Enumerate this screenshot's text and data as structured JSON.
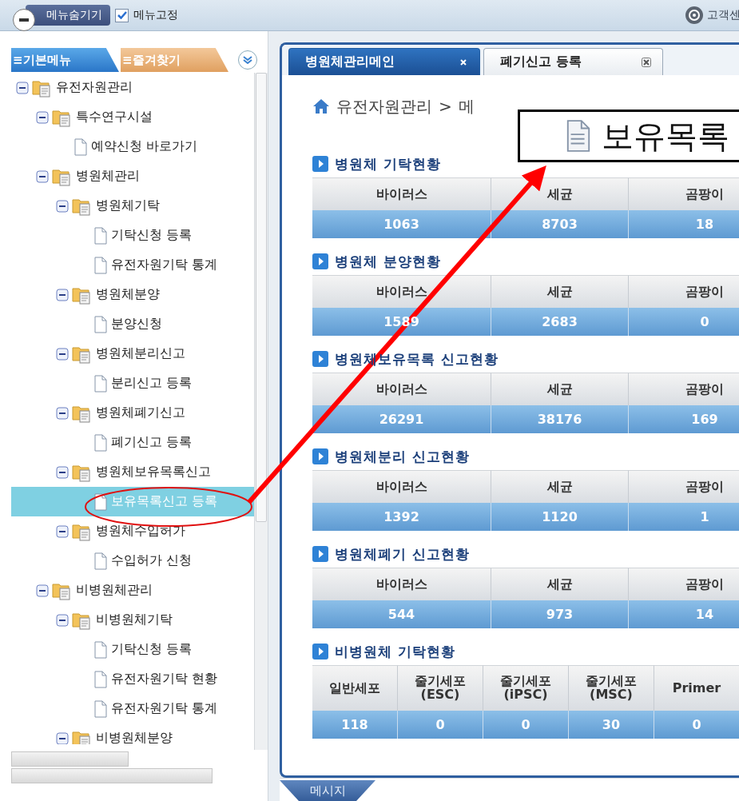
{
  "topbar": {
    "hide_menu_button": "메뉴숨기기",
    "pin_menu": {
      "label": "메뉴고정",
      "checked": true
    },
    "customer_center": "고객센"
  },
  "sidebar": {
    "tabs": [
      {
        "label": "≡기본메뉴",
        "selected": true
      },
      {
        "label": "≡즐겨찾기",
        "selected": false
      }
    ],
    "tree": [
      {
        "label": "유전자원관리",
        "kind": "folder",
        "expanded": true,
        "selected": false,
        "children": [
          {
            "label": "특수연구시설",
            "kind": "folder",
            "expanded": true,
            "selected": false,
            "children": [
              {
                "label": "예약신청 바로가기",
                "kind": "page",
                "selected": false
              }
            ]
          },
          {
            "label": "병원체관리",
            "kind": "folder",
            "expanded": true,
            "selected": false,
            "children": [
              {
                "label": "병원체기탁",
                "kind": "folder",
                "expanded": true,
                "selected": false,
                "children": [
                  {
                    "label": "기탁신청 등록",
                    "kind": "page",
                    "selected": false
                  },
                  {
                    "label": "유전자원기탁 통계",
                    "kind": "page",
                    "selected": false
                  }
                ]
              },
              {
                "label": "병원체분양",
                "kind": "folder",
                "expanded": true,
                "selected": false,
                "children": [
                  {
                    "label": "분양신청",
                    "kind": "page",
                    "selected": false
                  }
                ]
              },
              {
                "label": "병원체분리신고",
                "kind": "folder",
                "expanded": true,
                "selected": false,
                "children": [
                  {
                    "label": "분리신고 등록",
                    "kind": "page",
                    "selected": false
                  }
                ]
              },
              {
                "label": "병원체폐기신고",
                "kind": "folder",
                "expanded": true,
                "selected": false,
                "children": [
                  {
                    "label": "폐기신고 등록",
                    "kind": "page",
                    "selected": false
                  }
                ]
              },
              {
                "label": "병원체보유목록신고",
                "kind": "folder",
                "expanded": true,
                "selected": false,
                "children": [
                  {
                    "label": "보유목록신고 등록",
                    "kind": "page",
                    "selected": true
                  }
                ]
              },
              {
                "label": "병원체수입허가",
                "kind": "folder",
                "expanded": true,
                "selected": false,
                "children": [
                  {
                    "label": "수입허가 신청",
                    "kind": "page",
                    "selected": false
                  }
                ]
              }
            ]
          },
          {
            "label": "비병원체관리",
            "kind": "folder",
            "expanded": true,
            "selected": false,
            "children": [
              {
                "label": "비병원체기탁",
                "kind": "folder",
                "expanded": true,
                "selected": false,
                "children": [
                  {
                    "label": "기탁신청 등록",
                    "kind": "page",
                    "selected": false
                  },
                  {
                    "label": "유전자원기탁 현황",
                    "kind": "page",
                    "selected": false
                  },
                  {
                    "label": "유전자원기탁 통계",
                    "kind": "page",
                    "selected": false
                  }
                ]
              },
              {
                "label": "비병원체분양",
                "kind": "folder",
                "expanded": true,
                "selected": false
              }
            ]
          }
        ]
      }
    ]
  },
  "content": {
    "tabs": [
      {
        "label": "병원체관리메인",
        "selected": true
      },
      {
        "label": "폐기신고 등록",
        "selected": false
      }
    ],
    "breadcrumb": {
      "root": "유전자원관리",
      "separator": ">",
      "current": "메"
    },
    "sections": [
      {
        "title": "병원체 기탁현황",
        "columns": [
          "바이러스",
          "세균",
          "곰팡이"
        ],
        "values": [
          "1063",
          "8703",
          "18"
        ]
      },
      {
        "title": "병원체 분양현황",
        "columns": [
          "바이러스",
          "세균",
          "곰팡이"
        ],
        "values": [
          "1589",
          "2683",
          "0"
        ]
      },
      {
        "title": "병원체보유목록 신고현황",
        "columns": [
          "바이러스",
          "세균",
          "곰팡이"
        ],
        "values": [
          "26291",
          "38176",
          "169"
        ]
      },
      {
        "title": "병원체분리 신고현황",
        "columns": [
          "바이러스",
          "세균",
          "곰팡이"
        ],
        "values": [
          "1392",
          "1120",
          "1"
        ]
      },
      {
        "title": "병원체폐기 신고현황",
        "columns": [
          "바이러스",
          "세균",
          "곰팡이"
        ],
        "values": [
          "544",
          "973",
          "14"
        ]
      },
      {
        "title": "비병원체 기탁현황",
        "columns": [
          "일반세포",
          "줄기세포\n(ESC)",
          "줄기세포\n(iPSC)",
          "줄기세포\n(MSC)",
          "Primer"
        ],
        "values": [
          "118",
          "0",
          "0",
          "30",
          "0"
        ]
      }
    ]
  },
  "callout": {
    "text": "보유목록"
  },
  "message_tab": "메시지"
}
